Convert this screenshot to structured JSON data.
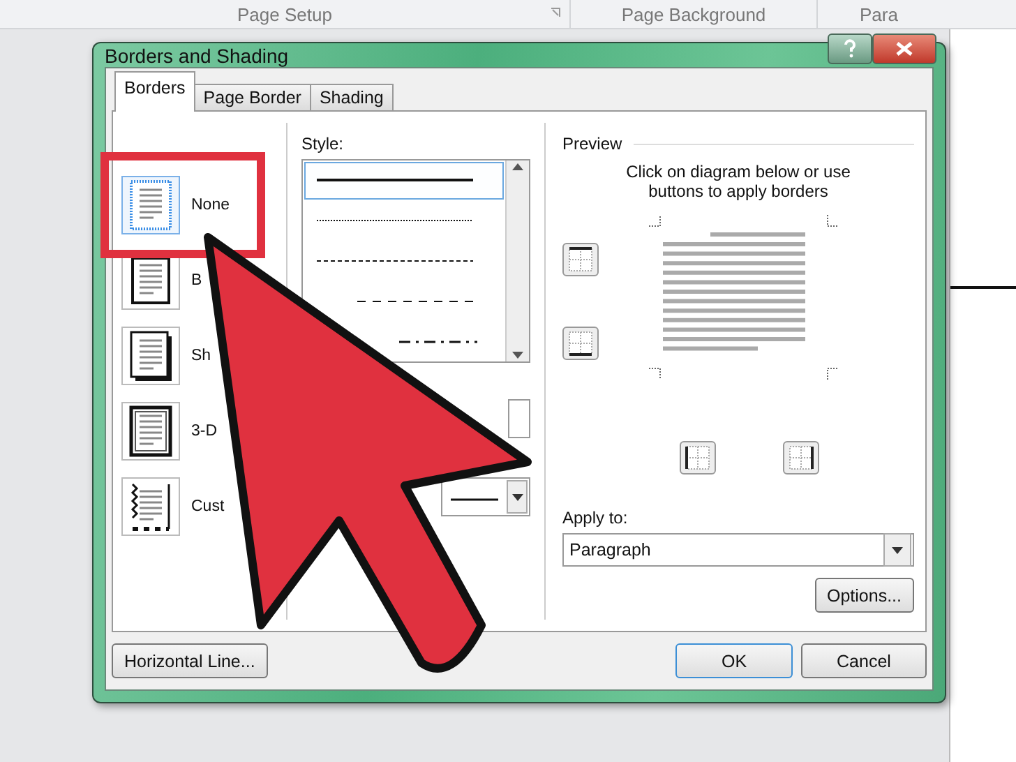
{
  "ribbon": {
    "groups": [
      {
        "label": "Page Setup",
        "launcher": true
      },
      {
        "label": "Page Background",
        "launcher": false
      },
      {
        "label": "Para",
        "launcher": false
      }
    ]
  },
  "dialog": {
    "title": "Borders and Shading",
    "tabs": [
      {
        "label": "Borders",
        "selected": true
      },
      {
        "label": "Page Border",
        "selected": false
      },
      {
        "label": "Shading",
        "selected": false
      }
    ],
    "setting": {
      "options": [
        {
          "label": "None",
          "kind": "none",
          "selected": true
        },
        {
          "label": "B",
          "kind": "box",
          "selected": false
        },
        {
          "label": "Sh",
          "kind": "shadow",
          "selected": false
        },
        {
          "label": "3-D",
          "kind": "threed",
          "selected": false
        },
        {
          "label": "Cust",
          "kind": "custom",
          "selected": false
        }
      ]
    },
    "style": {
      "label": "Style:",
      "lines": [
        {
          "kind": "solid",
          "selected": true
        },
        {
          "kind": "dotted",
          "selected": false
        },
        {
          "kind": "fine-dash",
          "selected": false
        },
        {
          "kind": "dash",
          "selected": false
        },
        {
          "kind": "dash-dot",
          "selected": false
        }
      ]
    },
    "preview": {
      "label": "Preview",
      "hint": "Click on diagram below or use buttons to apply borders"
    },
    "apply_to": {
      "label": "Apply to:",
      "value": "Paragraph"
    },
    "buttons": {
      "options": "Options...",
      "horizontal_line": "Horizontal Line...",
      "ok": "OK",
      "cancel": "Cancel"
    }
  }
}
